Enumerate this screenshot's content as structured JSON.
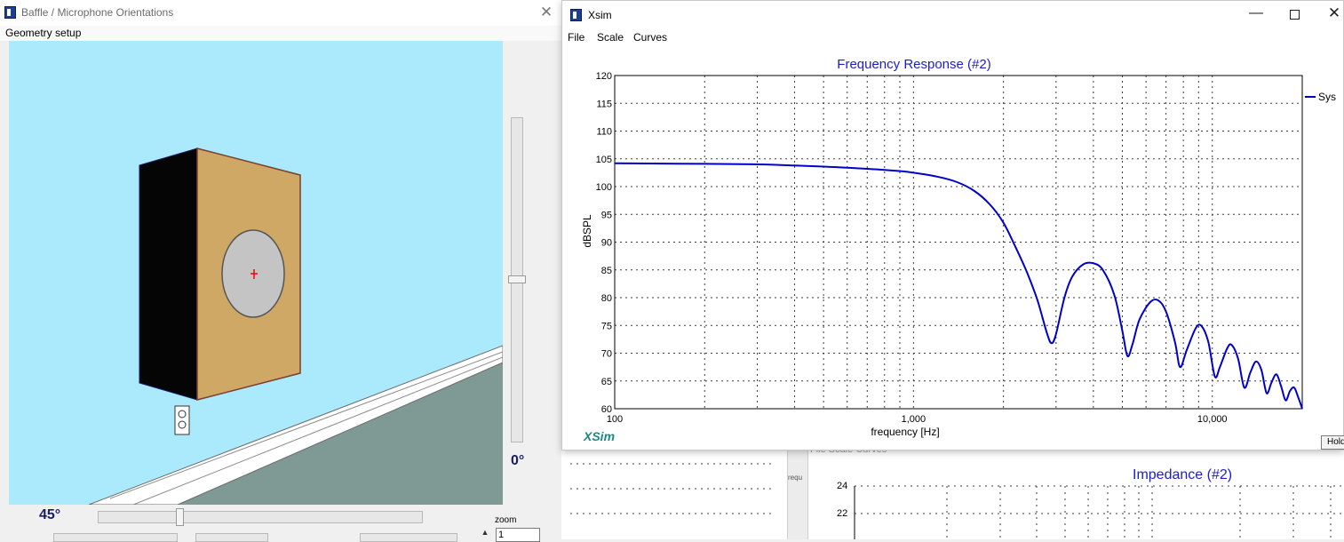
{
  "baffle_window": {
    "title": "Baffle / Microphone Orientations",
    "close_glyph": "✕",
    "menu": [
      "Geometry setup"
    ],
    "vertical_angle": "0°",
    "horizontal_angle": "45°",
    "zoom_label": "zoom",
    "zoom_value": "1",
    "colors": {
      "sky": "#abe9fc",
      "floor": "#7f9a94",
      "wall": "#ffffff",
      "cabinet_front": "#cfa866",
      "cabinet_side": "#050505",
      "driver": "#c4c4c4",
      "axis_mark": "#ff0000"
    }
  },
  "xsim_window": {
    "title": "Xsim",
    "controls": {
      "minimize": "—",
      "close": "✕"
    },
    "menu": [
      "File",
      "Scale",
      "Curves"
    ],
    "hold_label": "Hold",
    "brand": "XSim"
  },
  "background_window": {
    "menu_ghost": "File   Scale   Curves",
    "freq_ghost": "requ",
    "impedance_title": "Impedance (#2)",
    "y_ticks": [
      "24",
      "22"
    ]
  },
  "chart_data": {
    "type": "line",
    "title": "Frequency Response (#2)",
    "xlabel": "frequency [Hz]",
    "ylabel": "dBSPL",
    "x_scale": "log",
    "xlim": [
      100,
      20000
    ],
    "ylim": [
      60,
      120
    ],
    "x_tick_labels": [
      {
        "value": 100,
        "label": "100"
      },
      {
        "value": 1000,
        "label": "1,000"
      },
      {
        "value": 10000,
        "label": "10,000"
      }
    ],
    "y_ticks": [
      60,
      65,
      70,
      75,
      80,
      85,
      90,
      95,
      100,
      105,
      110,
      115,
      120
    ],
    "grid": true,
    "legend_position": "right",
    "colors": {
      "line": "#0000cc",
      "title": "#1c1cc8",
      "brand": "#1a8a86"
    },
    "series": [
      {
        "name": "Sys",
        "points": [
          [
            100,
            104.2
          ],
          [
            200,
            104.1
          ],
          [
            300,
            104.0
          ],
          [
            400,
            103.8
          ],
          [
            500,
            103.6
          ],
          [
            600,
            103.4
          ],
          [
            700,
            103.2
          ],
          [
            800,
            103.0
          ],
          [
            900,
            102.8
          ],
          [
            1000,
            102.5
          ],
          [
            1200,
            101.8
          ],
          [
            1400,
            100.8
          ],
          [
            1600,
            99.2
          ],
          [
            1800,
            96.8
          ],
          [
            2000,
            93.5
          ],
          [
            2200,
            89.0
          ],
          [
            2400,
            84.5
          ],
          [
            2600,
            79.5
          ],
          [
            2800,
            73.5
          ],
          [
            2900,
            71.8
          ],
          [
            3000,
            73.5
          ],
          [
            3200,
            80.0
          ],
          [
            3400,
            83.8
          ],
          [
            3700,
            86.0
          ],
          [
            4000,
            86.2
          ],
          [
            4300,
            85.0
          ],
          [
            4700,
            80.5
          ],
          [
            5000,
            74.0
          ],
          [
            5200,
            69.5
          ],
          [
            5400,
            71.5
          ],
          [
            5700,
            76.0
          ],
          [
            6200,
            79.2
          ],
          [
            6600,
            79.5
          ],
          [
            7000,
            77.5
          ],
          [
            7500,
            72.0
          ],
          [
            7800,
            67.5
          ],
          [
            8200,
            70.5
          ],
          [
            8800,
            74.5
          ],
          [
            9200,
            74.9
          ],
          [
            9700,
            72.0
          ],
          [
            10200,
            65.8
          ],
          [
            10600,
            67.5
          ],
          [
            11200,
            70.8
          ],
          [
            11600,
            71.5
          ],
          [
            12200,
            69.0
          ],
          [
            12800,
            63.8
          ],
          [
            13400,
            66.5
          ],
          [
            14000,
            68.5
          ],
          [
            14600,
            67.0
          ],
          [
            15200,
            62.8
          ],
          [
            15800,
            64.8
          ],
          [
            16400,
            66.2
          ],
          [
            17000,
            64.0
          ],
          [
            17600,
            61.5
          ],
          [
            18200,
            63.2
          ],
          [
            18800,
            63.8
          ],
          [
            19400,
            62.0
          ],
          [
            20000,
            60.0
          ]
        ]
      }
    ]
  }
}
